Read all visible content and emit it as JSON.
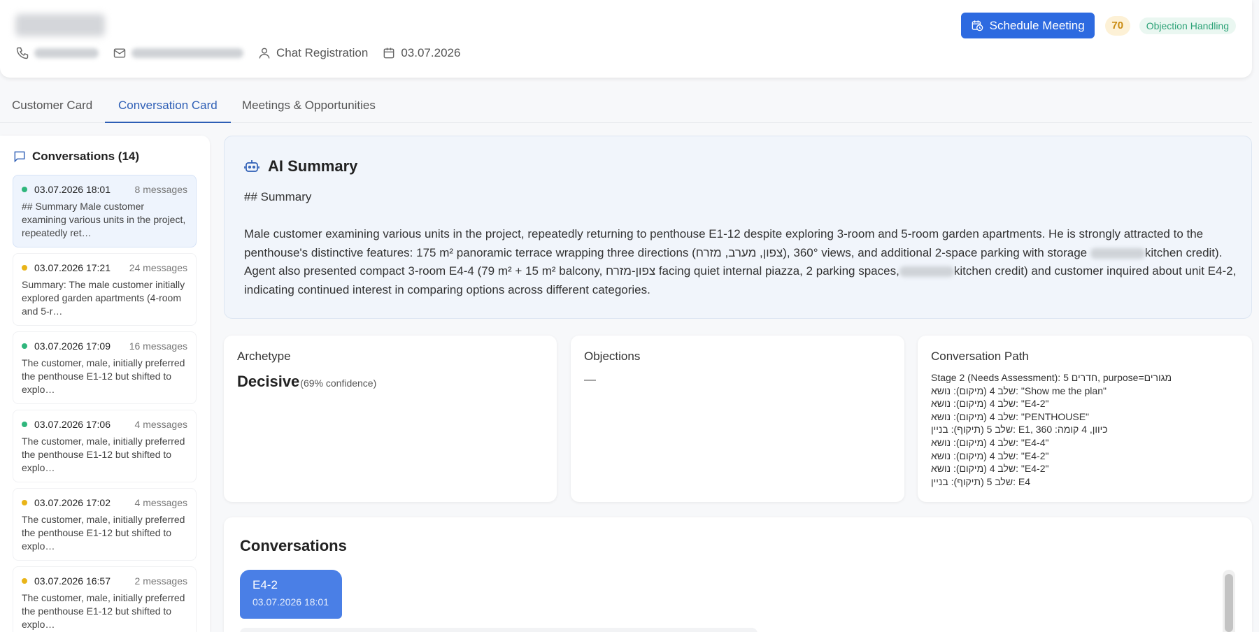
{
  "header": {
    "customer_name": "",
    "phone": "",
    "email": "",
    "source": "Chat Registration",
    "date": "03.07.2026",
    "schedule_button": "Schedule Meeting",
    "score": "70",
    "stage_tag": "Objection Handling",
    "icons": [
      "phone-icon",
      "mail-icon",
      "user-icon",
      "calendar-icon",
      "calendar-clock-icon"
    ]
  },
  "tabs": [
    {
      "label": "Customer Card",
      "active": false
    },
    {
      "label": "Conversation Card",
      "active": true
    },
    {
      "label": "Meetings & Opportunities",
      "active": false
    }
  ],
  "sidebar": {
    "title": "Conversations (14)",
    "items": [
      {
        "date": "03.07.2026 18:01",
        "count": "8 messages",
        "preview": "## Summary Male customer examining various units in the project, repeatedly ret…",
        "status": "green",
        "active": true
      },
      {
        "date": "03.07.2026 17:21",
        "count": "24 messages",
        "preview": "Summary: The male customer initially explored garden apartments (4-room and 5-r…",
        "status": "yellow",
        "active": false
      },
      {
        "date": "03.07.2026 17:09",
        "count": "16 messages",
        "preview": "The customer, male, initially preferred the penthouse E1-12 but shifted to explo…",
        "status": "green",
        "active": false
      },
      {
        "date": "03.07.2026 17:06",
        "count": "4 messages",
        "preview": "The customer, male, initially preferred the penthouse E1-12 but shifted to explo…",
        "status": "green",
        "active": false
      },
      {
        "date": "03.07.2026 17:02",
        "count": "4 messages",
        "preview": "The customer, male, initially preferred the penthouse E1-12 but shifted to explo…",
        "status": "yellow",
        "active": false
      },
      {
        "date": "03.07.2026 16:57",
        "count": "2 messages",
        "preview": "The customer, male, initially preferred the penthouse E1-12 but shifted to explo…",
        "status": "yellow",
        "active": false
      }
    ]
  },
  "ai_summary": {
    "title": "AI Summary",
    "heading": "## Summary",
    "body_part1": "Male customer examining various units in the project, repeatedly returning to penthouse E1-12 despite exploring 3-room and 5-room garden apartments. He is strongly attracted to the penthouse's distinctive features: 175 m² panoramic terrace wrapping three directions (צפון, מערב, מזרח), 360° views, and additional 2-space parking with storage ",
    "body_part2": "kitchen credit). Agent also presented compact 3-room E4-4 (79 m² + 15 m² balcony, צפון-מזרח facing quiet internal piazza, 2 parking spaces,",
    "body_part3": "kitchen credit) and customer inquired about unit E4-2, indicating continued interest in comparing options across different categories."
  },
  "archetype": {
    "label": "Archetype",
    "value": "Decisive",
    "confidence": "(69% confidence)"
  },
  "objections": {
    "label": "Objections",
    "value": "—"
  },
  "conversation_path": {
    "label": "Conversation Path",
    "lines": [
      "Stage 2 (Needs Assessment): 5 חדרים, purpose=מגורים",
      "שלב 4 (מיקום): נושא: \"Show me the plan\"",
      "שלב 4 (מיקום): נושא: \"E4-2\"",
      "שלב 4 (מיקום): נושא: \"PENTHOUSE\"",
      "שלב 5 (תיקוף): בניין: E1, 360 :כיוון, 4 קומה",
      "שלב 4 (מיקום): נושא: \"E4-4\"",
      "שלב 4 (מיקום): נושא: \"E4-2\"",
      "שלב 4 (מיקום): נושא: \"E4-2\"",
      "שלב 5 (תיקוף): בניין: E4"
    ]
  },
  "conversations": {
    "title": "Conversations",
    "chips": [
      {
        "label": "E4-2",
        "date": "03.07.2026 18:01"
      }
    ]
  },
  "colors": {
    "accent": "#2d6ae0",
    "tab_active": "#2d5eb5",
    "status_green": "#2fb67c",
    "status_yellow": "#e9b418",
    "score": "#c98a10",
    "tag": "#2ea378"
  }
}
